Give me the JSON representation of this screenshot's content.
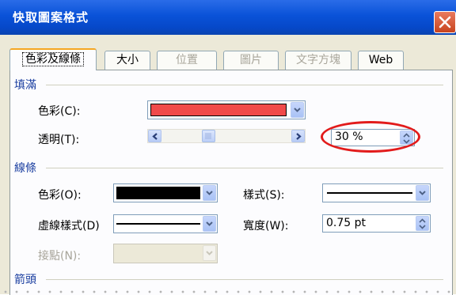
{
  "window": {
    "title": "快取圖案格式"
  },
  "tabs": [
    {
      "label": "色彩及線條",
      "state": "active"
    },
    {
      "label": "大小",
      "state": "enabled"
    },
    {
      "label": "位置",
      "state": "disabled"
    },
    {
      "label": "圖片",
      "state": "disabled"
    },
    {
      "label": "文字方塊",
      "state": "disabled"
    },
    {
      "label": "Web",
      "state": "enabled"
    }
  ],
  "fill": {
    "section_label": "填滿",
    "color_label": "色彩(C):",
    "color_value": "#f04a4a",
    "transparency_label": "透明(T):",
    "transparency_value": "30 %",
    "transparency_fraction": 0.3
  },
  "line": {
    "section_label": "線條",
    "color_label": "色彩(O):",
    "color_value": "#000000",
    "style_label": "樣式(S):",
    "dash_label": "虛線樣式(D)",
    "weight_label": "寬度(W):",
    "weight_value": "0.75 pt",
    "connector_label": "接點(N):"
  },
  "arrows": {
    "section_label": "箭頭"
  },
  "colors": {
    "title_bar": "#0a52d8",
    "highlight_oval": "#e21b1b",
    "section_text": "#1a3ea0"
  }
}
